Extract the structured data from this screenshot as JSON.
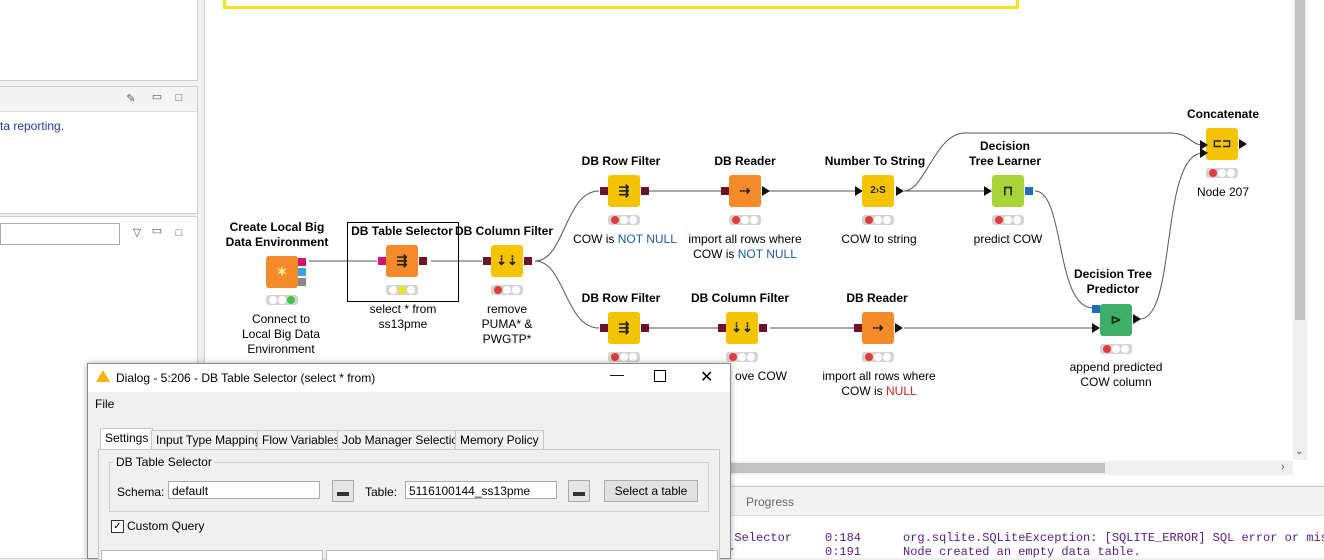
{
  "left": {
    "desc_text": "ta reporting."
  },
  "canvas": {
    "nodes": [
      {
        "id": "create-local",
        "title_lines": [
          "Create Local Big",
          "Data Environment"
        ],
        "label_lines": [
          "Connect to",
          "Local Big Data",
          "Environment"
        ]
      },
      {
        "id": "db-table-selector",
        "title": "DB Table Selector",
        "label_lines": [
          "select * from",
          "ss13pme"
        ]
      },
      {
        "id": "db-column-filter-1",
        "title": "DB Column Filter",
        "label_lines": [
          "remove",
          "PUMA* &",
          "PWGTP*"
        ]
      },
      {
        "id": "db-row-filter-1",
        "title": "DB Row Filter",
        "label_pre": "COW is ",
        "label_em": "NOT NULL"
      },
      {
        "id": "db-reader-1",
        "title": "DB Reader",
        "label_line1": "import all rows where",
        "label_pre": "COW is ",
        "label_em": "NOT NULL"
      },
      {
        "id": "number-to-string",
        "title": "Number To String",
        "label": "COW to string",
        "glyph": "2›S"
      },
      {
        "id": "dt-learner",
        "title_lines": [
          "Decision",
          "Tree Learner"
        ],
        "label": "predict COW"
      },
      {
        "id": "concatenate",
        "title": "Concatenate",
        "label": "Node 207"
      },
      {
        "id": "db-row-filter-2",
        "title": "DB Row Filter",
        "label": ""
      },
      {
        "id": "db-column-filter-2",
        "title": "DB Column Filter",
        "label": "ove COW"
      },
      {
        "id": "db-reader-2",
        "title": "DB Reader",
        "label_line1": "import all rows where",
        "label_pre": "COW is ",
        "label_em": "NULL"
      },
      {
        "id": "dt-predictor",
        "title_lines": [
          "Decision Tree",
          "Predictor"
        ],
        "label_lines": [
          "append predicted",
          "COW column"
        ]
      }
    ]
  },
  "console": {
    "progress_label": "Progress",
    "rows": [
      {
        "col1": "e Selector",
        "col2": "0:184",
        "col3": "org.sqlite.SQLiteException: [SQLITE_ERROR] SQL error or miss"
      },
      {
        "col1": "er",
        "col2": "0:191",
        "col3": "Node created an empty data table."
      }
    ]
  },
  "dialog": {
    "title": "Dialog - 5:206 - DB Table Selector (select * from)",
    "menu_file": "File",
    "tabs": [
      "Settings",
      "Input Type Mapping",
      "Flow Variables",
      "Job Manager Selection",
      "Memory Policy"
    ],
    "group_label": "DB Table Selector",
    "schema_label": "Schema:",
    "schema_value": "default",
    "table_label": "Table:",
    "table_value": "5116100144_ss13pme",
    "select_table_button": "Select a table",
    "custom_query_label": "Custom Query",
    "custom_query_checked": true
  },
  "colors": {
    "manipulator_yellow": "#f5c400",
    "source_orange": "#f58a2b",
    "learner_green": "#a8d43a",
    "predictor_green": "#3fae6a",
    "accent_blue": "#1f5aa6",
    "accent_red": "#e02020"
  }
}
